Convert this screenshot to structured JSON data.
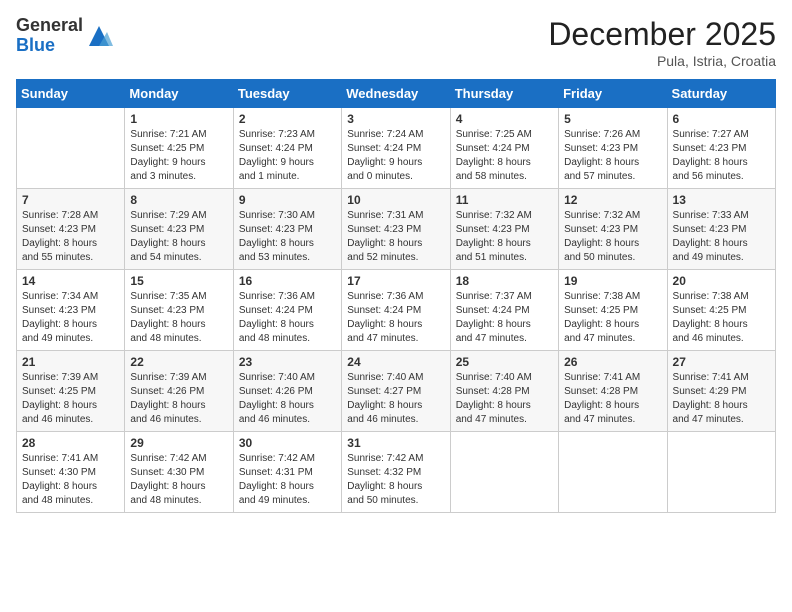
{
  "header": {
    "logo_general": "General",
    "logo_blue": "Blue",
    "month_title": "December 2025",
    "location": "Pula, Istria, Croatia"
  },
  "weekdays": [
    "Sunday",
    "Monday",
    "Tuesday",
    "Wednesday",
    "Thursday",
    "Friday",
    "Saturday"
  ],
  "weeks": [
    [
      {
        "day": "",
        "info": ""
      },
      {
        "day": "1",
        "info": "Sunrise: 7:21 AM\nSunset: 4:25 PM\nDaylight: 9 hours\nand 3 minutes."
      },
      {
        "day": "2",
        "info": "Sunrise: 7:23 AM\nSunset: 4:24 PM\nDaylight: 9 hours\nand 1 minute."
      },
      {
        "day": "3",
        "info": "Sunrise: 7:24 AM\nSunset: 4:24 PM\nDaylight: 9 hours\nand 0 minutes."
      },
      {
        "day": "4",
        "info": "Sunrise: 7:25 AM\nSunset: 4:24 PM\nDaylight: 8 hours\nand 58 minutes."
      },
      {
        "day": "5",
        "info": "Sunrise: 7:26 AM\nSunset: 4:23 PM\nDaylight: 8 hours\nand 57 minutes."
      },
      {
        "day": "6",
        "info": "Sunrise: 7:27 AM\nSunset: 4:23 PM\nDaylight: 8 hours\nand 56 minutes."
      }
    ],
    [
      {
        "day": "7",
        "info": "Sunrise: 7:28 AM\nSunset: 4:23 PM\nDaylight: 8 hours\nand 55 minutes."
      },
      {
        "day": "8",
        "info": "Sunrise: 7:29 AM\nSunset: 4:23 PM\nDaylight: 8 hours\nand 54 minutes."
      },
      {
        "day": "9",
        "info": "Sunrise: 7:30 AM\nSunset: 4:23 PM\nDaylight: 8 hours\nand 53 minutes."
      },
      {
        "day": "10",
        "info": "Sunrise: 7:31 AM\nSunset: 4:23 PM\nDaylight: 8 hours\nand 52 minutes."
      },
      {
        "day": "11",
        "info": "Sunrise: 7:32 AM\nSunset: 4:23 PM\nDaylight: 8 hours\nand 51 minutes."
      },
      {
        "day": "12",
        "info": "Sunrise: 7:32 AM\nSunset: 4:23 PM\nDaylight: 8 hours\nand 50 minutes."
      },
      {
        "day": "13",
        "info": "Sunrise: 7:33 AM\nSunset: 4:23 PM\nDaylight: 8 hours\nand 49 minutes."
      }
    ],
    [
      {
        "day": "14",
        "info": "Sunrise: 7:34 AM\nSunset: 4:23 PM\nDaylight: 8 hours\nand 49 minutes."
      },
      {
        "day": "15",
        "info": "Sunrise: 7:35 AM\nSunset: 4:23 PM\nDaylight: 8 hours\nand 48 minutes."
      },
      {
        "day": "16",
        "info": "Sunrise: 7:36 AM\nSunset: 4:24 PM\nDaylight: 8 hours\nand 48 minutes."
      },
      {
        "day": "17",
        "info": "Sunrise: 7:36 AM\nSunset: 4:24 PM\nDaylight: 8 hours\nand 47 minutes."
      },
      {
        "day": "18",
        "info": "Sunrise: 7:37 AM\nSunset: 4:24 PM\nDaylight: 8 hours\nand 47 minutes."
      },
      {
        "day": "19",
        "info": "Sunrise: 7:38 AM\nSunset: 4:25 PM\nDaylight: 8 hours\nand 47 minutes."
      },
      {
        "day": "20",
        "info": "Sunrise: 7:38 AM\nSunset: 4:25 PM\nDaylight: 8 hours\nand 46 minutes."
      }
    ],
    [
      {
        "day": "21",
        "info": "Sunrise: 7:39 AM\nSunset: 4:25 PM\nDaylight: 8 hours\nand 46 minutes."
      },
      {
        "day": "22",
        "info": "Sunrise: 7:39 AM\nSunset: 4:26 PM\nDaylight: 8 hours\nand 46 minutes."
      },
      {
        "day": "23",
        "info": "Sunrise: 7:40 AM\nSunset: 4:26 PM\nDaylight: 8 hours\nand 46 minutes."
      },
      {
        "day": "24",
        "info": "Sunrise: 7:40 AM\nSunset: 4:27 PM\nDaylight: 8 hours\nand 46 minutes."
      },
      {
        "day": "25",
        "info": "Sunrise: 7:40 AM\nSunset: 4:28 PM\nDaylight: 8 hours\nand 47 minutes."
      },
      {
        "day": "26",
        "info": "Sunrise: 7:41 AM\nSunset: 4:28 PM\nDaylight: 8 hours\nand 47 minutes."
      },
      {
        "day": "27",
        "info": "Sunrise: 7:41 AM\nSunset: 4:29 PM\nDaylight: 8 hours\nand 47 minutes."
      }
    ],
    [
      {
        "day": "28",
        "info": "Sunrise: 7:41 AM\nSunset: 4:30 PM\nDaylight: 8 hours\nand 48 minutes."
      },
      {
        "day": "29",
        "info": "Sunrise: 7:42 AM\nSunset: 4:30 PM\nDaylight: 8 hours\nand 48 minutes."
      },
      {
        "day": "30",
        "info": "Sunrise: 7:42 AM\nSunset: 4:31 PM\nDaylight: 8 hours\nand 49 minutes."
      },
      {
        "day": "31",
        "info": "Sunrise: 7:42 AM\nSunset: 4:32 PM\nDaylight: 8 hours\nand 50 minutes."
      },
      {
        "day": "",
        "info": ""
      },
      {
        "day": "",
        "info": ""
      },
      {
        "day": "",
        "info": ""
      }
    ]
  ]
}
